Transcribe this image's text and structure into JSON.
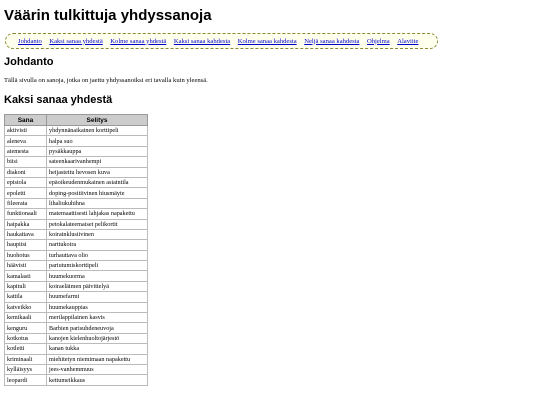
{
  "page": {
    "title": "Väärin tulkittuja yhdyssanoja"
  },
  "nav": {
    "items": [
      {
        "label": "Johdanto"
      },
      {
        "label": "Kaksi sanaa yhdestä"
      },
      {
        "label": "Kolme sanaa yhdestä"
      },
      {
        "label": "Kaksi sanaa kahdesta"
      },
      {
        "label": "Kolme sanaa kahdesta"
      },
      {
        "label": "Neljä sanaa kahdesta"
      },
      {
        "label": "Ohjelma"
      },
      {
        "label": "Alaviite"
      }
    ]
  },
  "intro": {
    "heading": "Johdanto",
    "text": "Tällä sivulla on sanoja, jotka on jaettu yhdyssanoiksi eri tavalla kuin yleensä."
  },
  "section": {
    "heading": "Kaksi sanaa yhdestä",
    "columns": [
      "Sana",
      "Selitys"
    ],
    "rows": [
      [
        "aktivisti",
        "yhdynnänaikainen korttipeli"
      ],
      [
        "aleneva",
        "halpa suo"
      ],
      [
        "aiemesta",
        "pysäkkauppa"
      ],
      [
        "biisi",
        "sateenkaarivanhempi"
      ],
      [
        "diakoni",
        "heijastettu hevosen kuva"
      ],
      [
        "epistola",
        "epäoikeudenmukainen asiaintila"
      ],
      [
        "epoletti",
        "doping-positiivinen hiusmäyte"
      ],
      [
        "fileerata",
        "lihaliukuhihna"
      ],
      [
        "funktionaali",
        "matemaattisesti lahjakas napakettu"
      ],
      [
        "haipakka",
        "petokalateemaiset pelikortit"
      ],
      [
        "haukattava",
        "koirainklusiivinen"
      ],
      [
        "haupitsi",
        "narttukoira"
      ],
      [
        "huohotus",
        "turhauttava olio"
      ],
      [
        "häävisti",
        "pariutumiskorttipeli"
      ],
      [
        "kamalasti",
        "huumekuorma"
      ],
      [
        "kapituli",
        "koiraeläimen päivittelyä"
      ],
      [
        "kattila",
        "huumefarmi"
      ],
      [
        "katveikko",
        "huumekauppias"
      ],
      [
        "kemikaali",
        "merilappilainen kasvis"
      ],
      [
        "kenguru",
        "Barbien parisuhdeneuvoja"
      ],
      [
        "kotkotus",
        "kanojen kielenhuoltojärjestö"
      ],
      [
        "kotletti",
        "kanan tukka"
      ],
      [
        "kriminaali",
        "miehitetyn niemimaan napakettu"
      ],
      [
        "kylläisyys",
        "jees-vanhemmuus"
      ],
      [
        "leopardi",
        "kettumeikkaus"
      ]
    ]
  }
}
